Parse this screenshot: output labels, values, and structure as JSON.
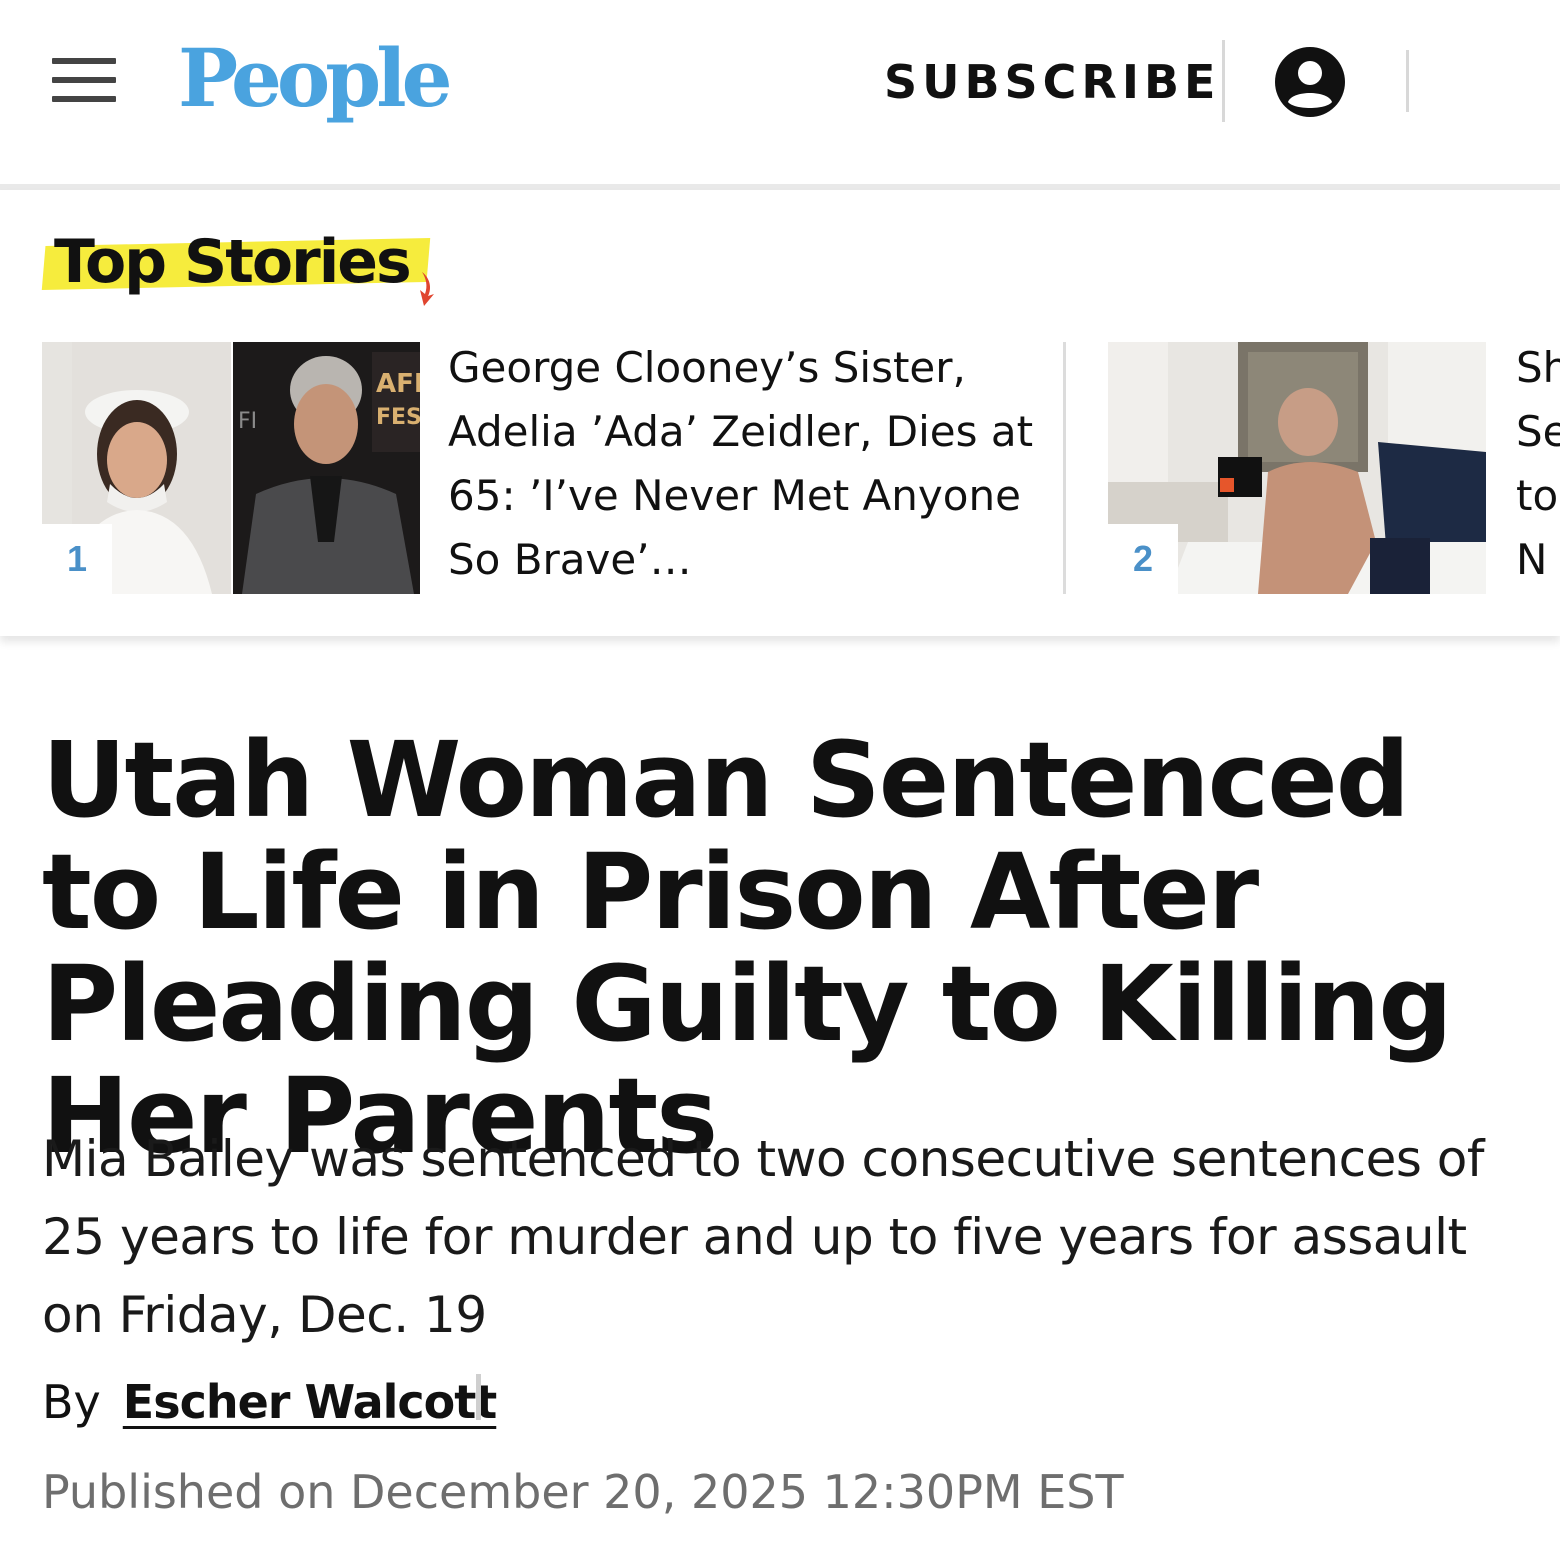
{
  "header": {
    "logo": "People",
    "subscribe_label": "SUBSCRIBE",
    "icons": [
      "menu-icon",
      "account-icon"
    ]
  },
  "top_stories": {
    "title": "Top Stories",
    "cards": [
      {
        "rank": "1",
        "text": "George Clooney’s Sister, Adelia ’Ada’ Zeidler, Dies at 65: ’I’ve Never Met Anyone So Brave’…"
      },
      {
        "rank": "2",
        "text": "Sh Se to N"
      }
    ]
  },
  "article": {
    "headline": "Utah Woman Sentenced to Life in Prison After Pleading Guilty to Killing Her Parents",
    "dek": "Mia Bailey was sentenced to two consecutive sentences of 25 years to life for murder and up to five years for assault on Friday, Dec. 19",
    "byline_prefix": "By",
    "author": "Escher Walcott",
    "published": "Published on December 20, 2025 12:30PM EST"
  },
  "colors": {
    "logo_blue": "#4aa3df",
    "highlight_yellow": "#f6ec3d",
    "rank_blue": "#4a90c8",
    "meta_gray": "#6e6e6e"
  }
}
